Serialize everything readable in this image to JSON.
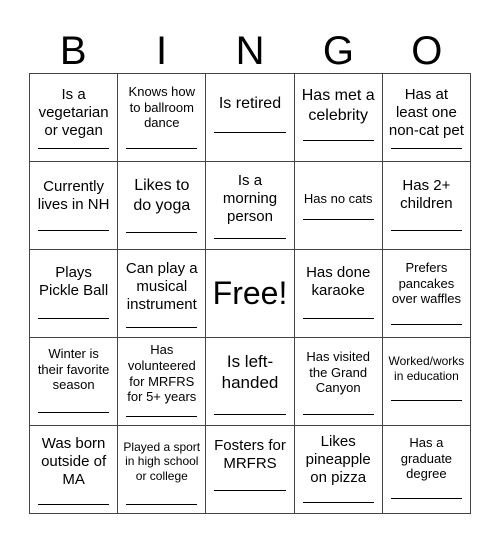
{
  "header": {
    "letters": [
      "B",
      "I",
      "N",
      "G",
      "O"
    ]
  },
  "card": {
    "rows": [
      [
        "Is a vegetarian or vegan",
        "Knows how to ballroom dance",
        "Is retired",
        "Has met a celebrity",
        "Has at least one non-cat pet"
      ],
      [
        "Currently lives in NH",
        "Likes to do yoga",
        "Is a morning person",
        "Has no cats",
        "Has 2+ children"
      ],
      [
        "Plays Pickle Ball",
        "Can play a musical instrument",
        "Free!",
        "Has done karaoke",
        "Prefers pancakes over waffles"
      ],
      [
        "Winter is their favorite season",
        "Has volunteered for MRFRS for 5+ years",
        "Is left-handed",
        "Has visited the Grand Canyon",
        "Worked/works in education"
      ],
      [
        "Was born outside of MA",
        "Played a sport in high school or college",
        "Fosters for MRFRS",
        "Likes pineapple on pizza",
        "Has a graduate degree"
      ]
    ]
  }
}
